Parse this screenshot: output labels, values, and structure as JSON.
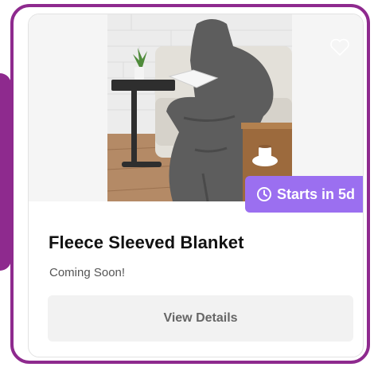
{
  "product": {
    "title": "Fleece Sleeved Blanket",
    "status": "Coming Soon!",
    "badge_text": "Starts in 5d",
    "button_label": "View Details"
  },
  "colors": {
    "frame": "#8e2a8e",
    "badge": "#9b6ff0",
    "button_bg": "#f2f2f2"
  },
  "icons": {
    "favorite": "heart-outline-icon",
    "badge": "clock-icon"
  }
}
